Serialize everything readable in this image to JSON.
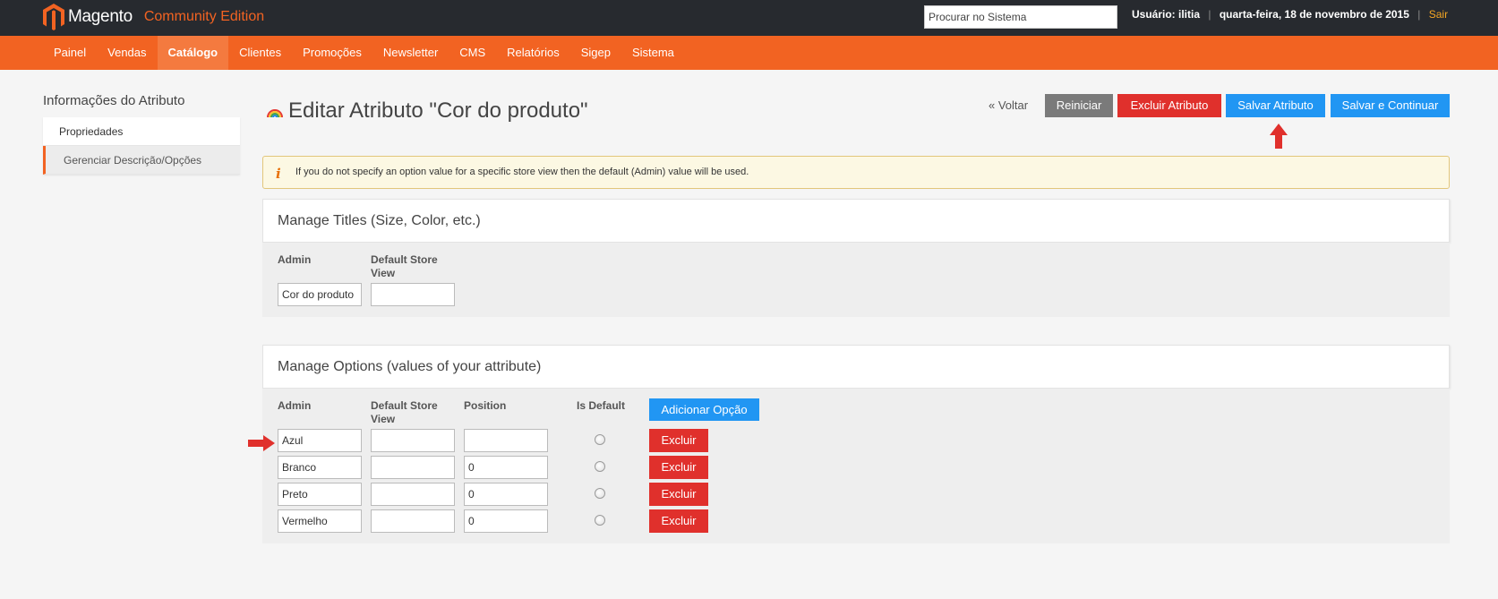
{
  "header": {
    "brand_name": "Magento",
    "brand_edition": "Community Edition",
    "search_placeholder": "Procurar no Sistema",
    "user_label": "Usuário: ilitia",
    "date": "quarta-feira, 18 de novembro de 2015",
    "logout": "Sair",
    "separator": "|"
  },
  "nav": {
    "items": [
      {
        "label": "Painel"
      },
      {
        "label": "Vendas"
      },
      {
        "label": "Catálogo"
      },
      {
        "label": "Clientes"
      },
      {
        "label": "Promoções"
      },
      {
        "label": "Newsletter"
      },
      {
        "label": "CMS"
      },
      {
        "label": "Relatórios"
      },
      {
        "label": "Sigep"
      },
      {
        "label": "Sistema"
      }
    ],
    "active": "Catálogo"
  },
  "sidebar": {
    "title": "Informações do Atributo",
    "items": [
      {
        "label": "Propriedades"
      },
      {
        "label": "Gerenciar Descrição/Opções"
      }
    ],
    "active": "Gerenciar Descrição/Opções"
  },
  "page": {
    "title": "Editar Atributo \"Cor do produto\"",
    "back": "« Voltar",
    "reset": "Reiniciar",
    "delete": "Excluir Atributo",
    "save": "Salvar Atributo",
    "save_continue": "Salvar e Continuar"
  },
  "notice": {
    "icon": "i",
    "text": "If you do not specify an option value for a specific store view then the default (Admin) value will be used."
  },
  "titles_panel": {
    "heading": "Manage Titles (Size, Color, etc.)",
    "col_admin": "Admin",
    "col_default_store_line1": "Default Store",
    "col_default_store_line2": "View",
    "admin_value": "Cor do produto",
    "default_store_value": ""
  },
  "options_panel": {
    "heading": "Manage Options (values of your attribute)",
    "col_admin": "Admin",
    "col_default_store_line1": "Default Store",
    "col_default_store_line2": "View",
    "col_position": "Position",
    "col_is_default": "Is Default",
    "add_button": "Adicionar Opção",
    "delete_label": "Excluir",
    "rows": [
      {
        "admin": "Azul",
        "store": "",
        "position": ""
      },
      {
        "admin": "Branco",
        "store": "",
        "position": "0"
      },
      {
        "admin": "Preto",
        "store": "",
        "position": "0"
      },
      {
        "admin": "Vermelho",
        "store": "",
        "position": "0"
      }
    ]
  },
  "colors": {
    "header_bg": "#272a2f",
    "nav_bg": "#f26322",
    "btn_gray": "#7a7a7a",
    "btn_red": "#e0302c",
    "btn_blue": "#2196f3",
    "arrow_red": "#e0302c"
  }
}
